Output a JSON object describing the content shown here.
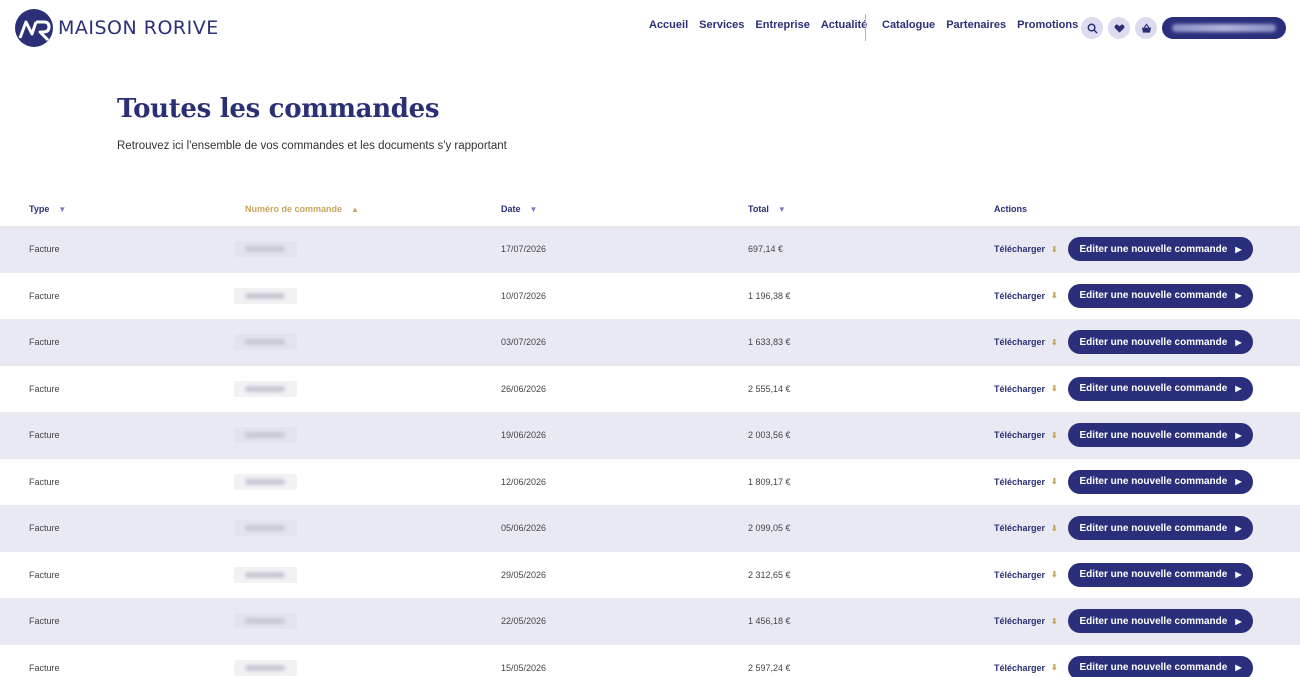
{
  "brand": {
    "name": "MAISON RORIVE",
    "primary": "#2b2f7b",
    "accent": "#c8a55f",
    "row_alt": "#e9e9f4"
  },
  "nav": {
    "primary": [
      "Accueil",
      "Services",
      "Entreprise",
      "Actualité"
    ],
    "secondary": [
      "Catalogue",
      "Partenaires",
      "Promotions"
    ]
  },
  "header_icons": [
    "search-icon",
    "heart-icon",
    "basket-icon"
  ],
  "user": {
    "name": ""
  },
  "page": {
    "title": "Toutes les commandes",
    "subtitle": "Retrouvez ici l'ensemble de vos commandes et les documents s'y rapportant"
  },
  "table": {
    "columns": [
      {
        "label": "Type",
        "arrow": "▼",
        "active": false
      },
      {
        "label": "Numéro de commande",
        "arrow": "▲",
        "active": true
      },
      {
        "label": "Date",
        "arrow": "▼",
        "active": false
      },
      {
        "label": "Total",
        "arrow": "▼",
        "active": false
      },
      {
        "label": "Actions",
        "arrow": "",
        "active": false
      }
    ],
    "download_label": "Télécharger",
    "edit_label": "Editer une nouvelle commande",
    "rows": [
      {
        "type": "Facture",
        "number": "",
        "date": "17/07/2026",
        "total": "697,14 €"
      },
      {
        "type": "Facture",
        "number": "",
        "date": "10/07/2026",
        "total": "1 196,38 €"
      },
      {
        "type": "Facture",
        "number": "",
        "date": "03/07/2026",
        "total": "1 633,83 €"
      },
      {
        "type": "Facture",
        "number": "",
        "date": "26/06/2026",
        "total": "2 555,14 €"
      },
      {
        "type": "Facture",
        "number": "",
        "date": "19/06/2026",
        "total": "2 003,56 €"
      },
      {
        "type": "Facture",
        "number": "",
        "date": "12/06/2026",
        "total": "1 809,17 €"
      },
      {
        "type": "Facture",
        "number": "",
        "date": "05/06/2026",
        "total": "2 099,05 €"
      },
      {
        "type": "Facture",
        "number": "",
        "date": "29/05/2026",
        "total": "2 312,65 €"
      },
      {
        "type": "Facture",
        "number": "",
        "date": "22/05/2026",
        "total": "1 456,18 €"
      },
      {
        "type": "Facture",
        "number": "",
        "date": "15/05/2026",
        "total": "2 597,24 €"
      }
    ]
  }
}
